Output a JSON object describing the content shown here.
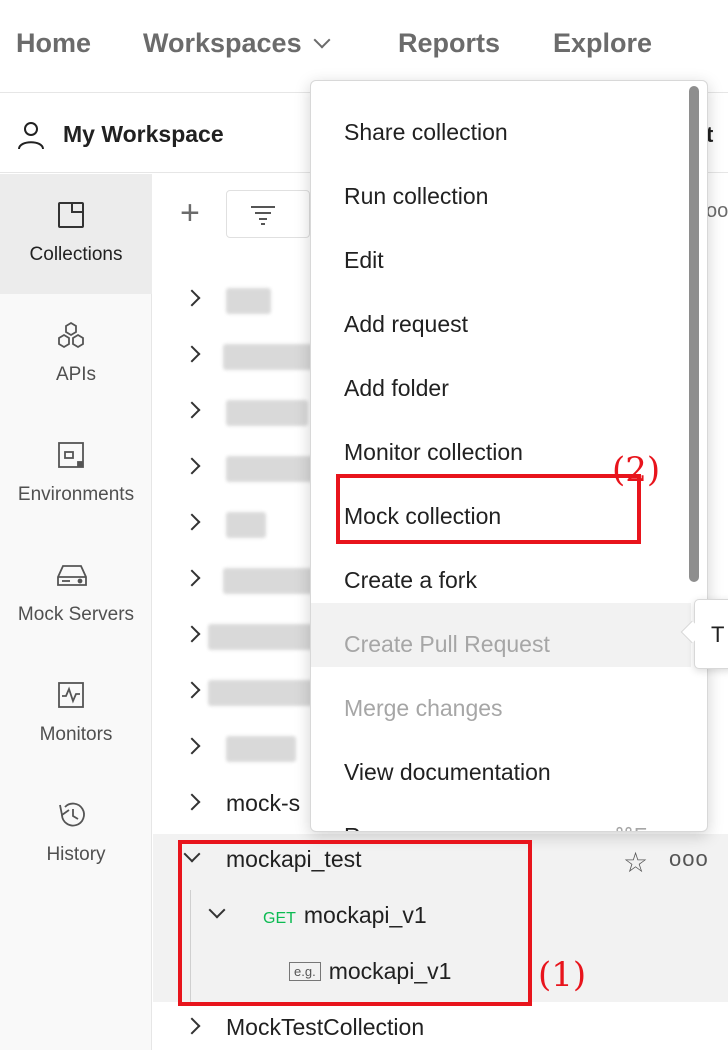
{
  "topnav": {
    "home": "Home",
    "workspaces": "Workspaces",
    "reports": "Reports",
    "explore": "Explore"
  },
  "workspace": {
    "title": "My Workspace",
    "truncated": "t"
  },
  "rail": {
    "items": [
      {
        "label": "Collections",
        "icon": "collections-icon",
        "active": true
      },
      {
        "label": "APIs",
        "icon": "apis-icon"
      },
      {
        "label": "Environments",
        "icon": "environments-icon"
      },
      {
        "label": "Mock Servers",
        "icon": "mock-servers-icon"
      },
      {
        "label": "Monitors",
        "icon": "monitors-icon"
      },
      {
        "label": "History",
        "icon": "history-icon"
      }
    ]
  },
  "collections": {
    "visible_rows": [
      {
        "label": "mock-s"
      },
      {
        "label": "mockapi_test",
        "expanded": true
      },
      {
        "method": "GET",
        "label": "mockapi_v1",
        "expanded": true
      },
      {
        "badge": "e.g.",
        "label": "mockapi_v1"
      },
      {
        "label": "MockTestCollection"
      }
    ],
    "more_glyph": "ooo",
    "star_glyph": "☆"
  },
  "menu": {
    "items": [
      {
        "label": "Share collection"
      },
      {
        "label": "Run collection"
      },
      {
        "label": "Edit"
      },
      {
        "label": "Add request"
      },
      {
        "label": "Add folder"
      },
      {
        "label": "Monitor collection"
      },
      {
        "label": "Mock collection"
      },
      {
        "label": "Create a fork"
      },
      {
        "label": "Create Pull Request",
        "disabled": true
      },
      {
        "label": "Merge changes",
        "disabled": true
      },
      {
        "label": "View documentation"
      },
      {
        "label": "Rename",
        "shortcut": "⌘E"
      }
    ]
  },
  "tooltip": {
    "text": "T"
  },
  "annotations": {
    "one": "(1)",
    "two": "(2)",
    "color": "#e8141c"
  }
}
